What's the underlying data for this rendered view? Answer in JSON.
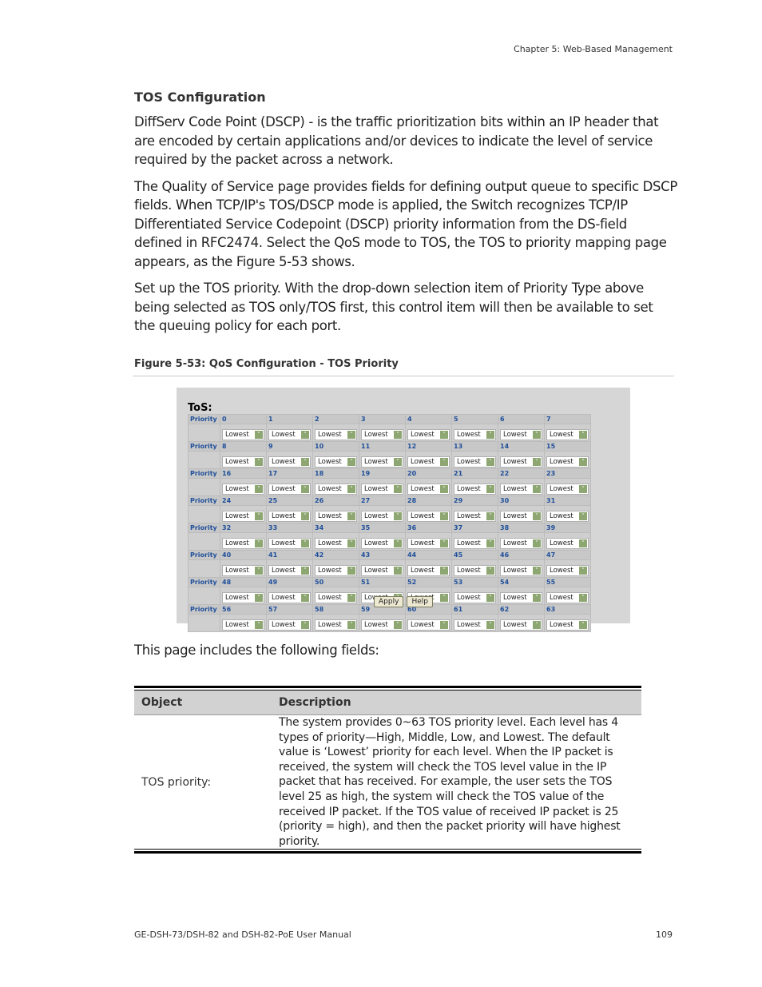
{
  "header": {
    "chapter": "Chapter 5: Web-Based Management"
  },
  "section": {
    "title": "TOS Configuration",
    "paragraphs": [
      "DiffServ Code Point (DSCP) - is the traffic prioritization bits within an IP header that are encoded by certain applications and/or devices to indicate the level of service required by the packet across a network.",
      "The Quality of Service page provides fields for defining output queue to specific DSCP fields. When TCP/IP's TOS/DSCP mode is applied, the Switch recognizes TCP/IP Differentiated Service Codepoint (DSCP) priority information from the DS-field defined in RFC2474. Select the QoS mode to TOS, the TOS to priority mapping page appears, as the Figure 5-53 shows.",
      "Set up the TOS priority. With the drop-down selection item of Priority Type above being selected as TOS only/TOS first, this control item will then be available to set the queuing policy for each port."
    ]
  },
  "figure": {
    "caption": "Figure 5-53:  QoS Configuration - TOS Priority",
    "panel_title": "ToS:",
    "row_label": "Priority",
    "default_value": "Lowest",
    "rows": [
      {
        "levels": [
          "0",
          "1",
          "2",
          "3",
          "4",
          "5",
          "6",
          "7"
        ],
        "values": [
          "Lowest",
          "Lowest",
          "Lowest",
          "Lowest",
          "Lowest",
          "Lowest",
          "Lowest",
          "Lowest"
        ]
      },
      {
        "levels": [
          "8",
          "9",
          "10",
          "11",
          "12",
          "13",
          "14",
          "15"
        ],
        "values": [
          "Lowest",
          "Lowest",
          "Lowest",
          "Lowest",
          "Lowest",
          "Lowest",
          "Lowest",
          "Lowest"
        ]
      },
      {
        "levels": [
          "16",
          "17",
          "18",
          "19",
          "20",
          "21",
          "22",
          "23"
        ],
        "values": [
          "Lowest",
          "Lowest",
          "Lowest",
          "Lowest",
          "Lowest",
          "Lowest",
          "Lowest",
          "Lowest"
        ]
      },
      {
        "levels": [
          "24",
          "25",
          "26",
          "27",
          "28",
          "29",
          "30",
          "31"
        ],
        "values": [
          "Lowest",
          "Lowest",
          "Lowest",
          "Lowest",
          "Lowest",
          "Lowest",
          "Lowest",
          "Lowest"
        ]
      },
      {
        "levels": [
          "32",
          "33",
          "34",
          "35",
          "36",
          "37",
          "38",
          "39"
        ],
        "values": [
          "Lowest",
          "Lowest",
          "Lowest",
          "Lowest",
          "Lowest",
          "Lowest",
          "Lowest",
          "Lowest"
        ]
      },
      {
        "levels": [
          "40",
          "41",
          "42",
          "43",
          "44",
          "45",
          "46",
          "47"
        ],
        "values": [
          "Lowest",
          "Lowest",
          "Lowest",
          "Lowest",
          "Lowest",
          "Lowest",
          "Lowest",
          "Lowest"
        ]
      },
      {
        "levels": [
          "48",
          "49",
          "50",
          "51",
          "52",
          "53",
          "54",
          "55"
        ],
        "values": [
          "Lowest",
          "Lowest",
          "Lowest",
          "Lowest",
          "Lowest",
          "Lowest",
          "Lowest",
          "Lowest"
        ]
      },
      {
        "levels": [
          "56",
          "57",
          "58",
          "59",
          "60",
          "61",
          "62",
          "63"
        ],
        "values": [
          "Lowest",
          "Lowest",
          "Lowest",
          "Lowest",
          "Lowest",
          "Lowest",
          "Lowest",
          "Lowest"
        ]
      }
    ],
    "buttons": {
      "apply": "Apply",
      "help": "Help"
    },
    "dropdown_icon": "chevron-down-icon"
  },
  "fields_intro": "This page includes the following fields:",
  "object_table": {
    "headers": {
      "object": "Object",
      "description": "Description"
    },
    "rows": [
      {
        "object": "TOS priority:",
        "description": "The system provides 0~63 TOS priority level. Each level has 4 types of priority—High, Middle, Low, and Lowest. The default value is ‘Lowest’ priority for each level. When the IP packet is received, the system will check the TOS level value in the IP packet that has received. For example, the user sets the TOS level 25 as high, the system will check the TOS value of the received IP packet. If the TOS value of received IP packet is 25 (priority = high), and then the packet priority will have highest priority."
      }
    ]
  },
  "footer": {
    "manual": "GE-DSH-73/DSH-82 and DSH-82-PoE User Manual",
    "page_number": "109"
  }
}
